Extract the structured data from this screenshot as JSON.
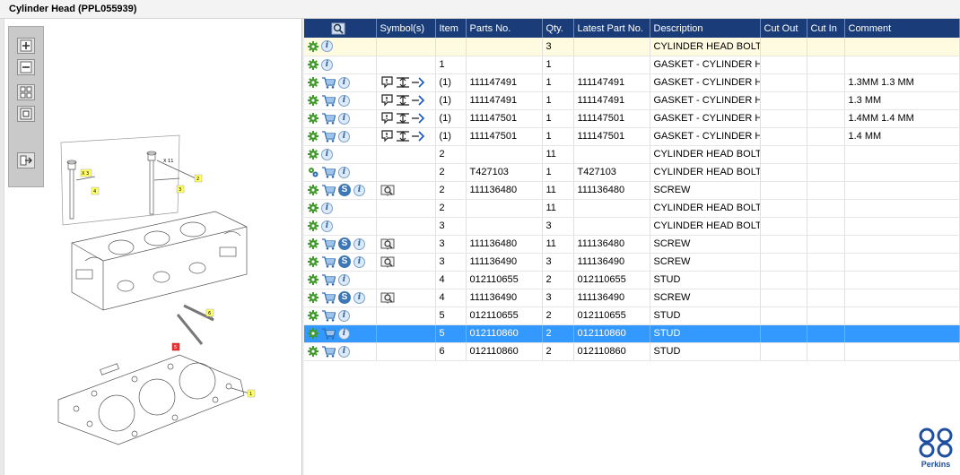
{
  "window": {
    "title": "Cylinder Head (PPL055939)"
  },
  "toolbar": {
    "buttons": [
      "zoom-in",
      "zoom-out",
      "fit-all",
      "fit-window",
      "export"
    ]
  },
  "diagram": {
    "callouts": [
      {
        "text": "X 3"
      },
      {
        "text": "X 11"
      },
      {
        "text": "1"
      },
      {
        "text": "2"
      },
      {
        "text": "3"
      },
      {
        "text": "4"
      },
      {
        "text": "5"
      },
      {
        "text": "6"
      }
    ]
  },
  "grid": {
    "columns": [
      "",
      "Symbol(s)",
      "Item",
      "Parts No.",
      "Qty.",
      "Latest Part No.",
      "Description",
      "Cut Out",
      "Cut In",
      "Comment"
    ],
    "rows": [
      {
        "icons": [
          "gear",
          "info"
        ],
        "symbols": 0,
        "item": "",
        "part": "",
        "qty": "3",
        "latest": "",
        "desc": "CYLINDER HEAD BOLT",
        "cutout": "",
        "cutin": "",
        "comment": "",
        "highlight": true
      },
      {
        "icons": [
          "gear",
          "info"
        ],
        "symbols": 0,
        "item": "1",
        "part": "",
        "qty": "1",
        "latest": "",
        "desc": "GASKET - CYLINDER HEA",
        "cutout": "",
        "cutin": "",
        "comment": ""
      },
      {
        "icons": [
          "gear",
          "cart",
          "info"
        ],
        "symbols": 3,
        "item": "(1)",
        "part": "111147491",
        "qty": "1",
        "latest": "111147491",
        "desc": "GASKET - CYLINDER HEA",
        "cutout": "",
        "cutin": "",
        "comment": "1.3MM  1.3 MM"
      },
      {
        "icons": [
          "gear",
          "cart",
          "info"
        ],
        "symbols": 3,
        "item": "(1)",
        "part": "111147491",
        "qty": "1",
        "latest": "111147491",
        "desc": "GASKET - CYLINDER HEA",
        "cutout": "",
        "cutin": "",
        "comment": "1.3 MM"
      },
      {
        "icons": [
          "gear",
          "cart",
          "info"
        ],
        "symbols": 3,
        "item": "(1)",
        "part": "111147501",
        "qty": "1",
        "latest": "111147501",
        "desc": "GASKET - CYLINDER HEA",
        "cutout": "",
        "cutin": "",
        "comment": "1.4MM  1.4 MM"
      },
      {
        "icons": [
          "gear",
          "cart",
          "info"
        ],
        "symbols": 3,
        "item": "(1)",
        "part": "111147501",
        "qty": "1",
        "latest": "111147501",
        "desc": "GASKET - CYLINDER HEA",
        "cutout": "",
        "cutin": "",
        "comment": "1.4 MM"
      },
      {
        "icons": [
          "gear",
          "info"
        ],
        "symbols": 0,
        "item": "2",
        "part": "",
        "qty": "11",
        "latest": "",
        "desc": "CYLINDER HEAD BOLT",
        "cutout": "",
        "cutin": "",
        "comment": ""
      },
      {
        "icons": [
          "gears",
          "cart",
          "info"
        ],
        "symbols": 0,
        "item": "2",
        "part": "T427103",
        "qty": "1",
        "latest": "T427103",
        "desc": "CYLINDER HEAD BOLT",
        "cutout": "",
        "cutin": "",
        "comment": ""
      },
      {
        "icons": [
          "gear",
          "cart",
          "s",
          "info"
        ],
        "symbols": 1,
        "item": "2",
        "part": "111136480",
        "qty": "11",
        "latest": "111136480",
        "desc": "SCREW",
        "cutout": "",
        "cutin": "",
        "comment": ""
      },
      {
        "icons": [
          "gear",
          "info"
        ],
        "symbols": 0,
        "item": "2",
        "part": "",
        "qty": "11",
        "latest": "",
        "desc": "CYLINDER HEAD BOLT",
        "cutout": "",
        "cutin": "",
        "comment": ""
      },
      {
        "icons": [
          "gear",
          "info"
        ],
        "symbols": 0,
        "item": "3",
        "part": "",
        "qty": "3",
        "latest": "",
        "desc": "CYLINDER HEAD BOLT",
        "cutout": "",
        "cutin": "",
        "comment": ""
      },
      {
        "icons": [
          "gear",
          "cart",
          "s",
          "info"
        ],
        "symbols": 1,
        "item": "3",
        "part": "111136480",
        "qty": "11",
        "latest": "111136480",
        "desc": "SCREW",
        "cutout": "",
        "cutin": "",
        "comment": ""
      },
      {
        "icons": [
          "gear",
          "cart",
          "s",
          "info"
        ],
        "symbols": 1,
        "item": "3",
        "part": "111136490",
        "qty": "3",
        "latest": "111136490",
        "desc": "SCREW",
        "cutout": "",
        "cutin": "",
        "comment": ""
      },
      {
        "icons": [
          "gear",
          "cart",
          "info"
        ],
        "symbols": 0,
        "item": "4",
        "part": "012110655",
        "qty": "2",
        "latest": "012110655",
        "desc": "STUD",
        "cutout": "",
        "cutin": "",
        "comment": ""
      },
      {
        "icons": [
          "gear",
          "cart",
          "s",
          "info"
        ],
        "symbols": 1,
        "item": "4",
        "part": "111136490",
        "qty": "3",
        "latest": "111136490",
        "desc": "SCREW",
        "cutout": "",
        "cutin": "",
        "comment": ""
      },
      {
        "icons": [
          "gear",
          "cart",
          "info"
        ],
        "symbols": 0,
        "item": "5",
        "part": "012110655",
        "qty": "2",
        "latest": "012110655",
        "desc": "STUD",
        "cutout": "",
        "cutin": "",
        "comment": ""
      },
      {
        "icons": [
          "gear",
          "cart",
          "info"
        ],
        "symbols": 0,
        "item": "5",
        "part": "012110860",
        "qty": "2",
        "latest": "012110860",
        "desc": "STUD",
        "cutout": "",
        "cutin": "",
        "comment": "",
        "selected": true
      },
      {
        "icons": [
          "gear",
          "cart",
          "info"
        ],
        "symbols": 0,
        "item": "6",
        "part": "012110860",
        "qty": "2",
        "latest": "012110860",
        "desc": "STUD",
        "cutout": "",
        "cutin": "",
        "comment": ""
      }
    ]
  },
  "logo": {
    "text": "Perkins"
  },
  "colors": {
    "header": "#1a3d7a",
    "selected": "#3399ff",
    "highlight": "#fffbe1",
    "gear": "#3f9a2a",
    "cart": "#2a6bb0"
  }
}
